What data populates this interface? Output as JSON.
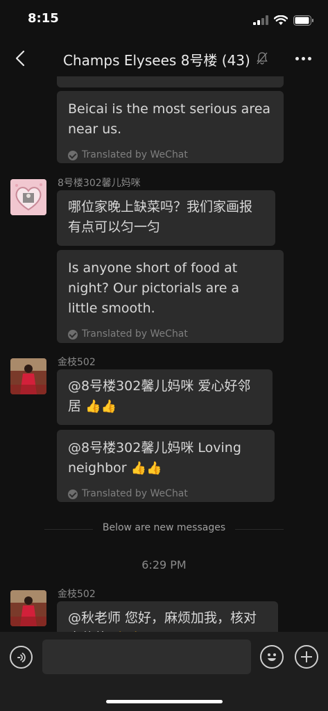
{
  "status_bar": {
    "time": "8:15"
  },
  "header": {
    "title": "Champs Elysees 8号楼 (43)",
    "muted": true
  },
  "messages": [
    {
      "translation": "Beicai is the most serious area near us.",
      "translated_by": "Translated by WeChat"
    },
    {
      "sender": "8号楼302馨儿妈咪",
      "text": "哪位家晚上缺菜吗？我们家画报有点可以匀一匀",
      "translation": "Is anyone short of food at night? Our pictorials are a little smooth.",
      "translated_by": "Translated by WeChat"
    },
    {
      "sender": "金枝502",
      "text": "@8号楼302馨儿妈咪 爱心好邻居",
      "translation": "@8号楼302馨儿妈咪 Loving neighbor",
      "translated_by": "Translated by WeChat"
    },
    {
      "sender": "金枝502",
      "text": "@秋老师 您好，麻烦加我，核对余什款"
    }
  ],
  "thumbs": "👍👍",
  "new_messages_label": "Below are new messages",
  "time_separator": "6:29 PM",
  "input": {
    "value": "",
    "placeholder": ""
  },
  "colors": {
    "background": "#111111",
    "bubble": "#2c2c2c",
    "input_bar": "#1e1e1e"
  }
}
